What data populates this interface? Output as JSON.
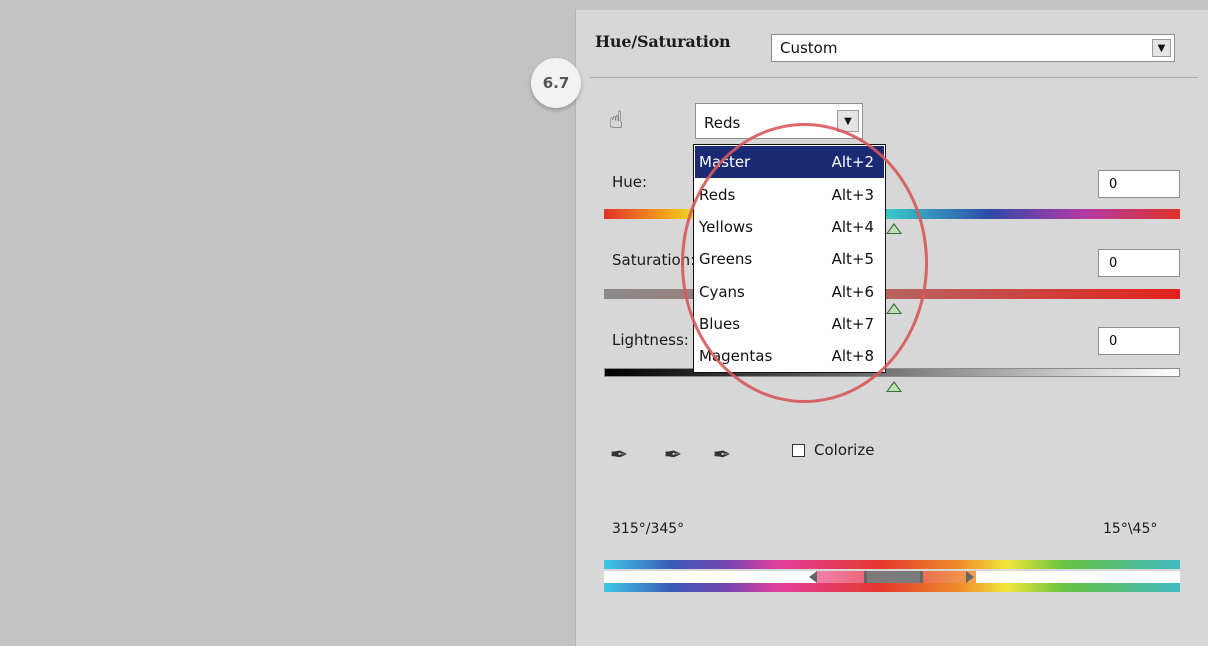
{
  "panel": {
    "title": "Hue/Saturation",
    "preset_value": "Custom",
    "step_badge": "6.7",
    "channel_value": "Reds"
  },
  "menu": {
    "items": [
      {
        "label": "Master",
        "shortcut": "Alt+2",
        "selected": true
      },
      {
        "label": "Reds",
        "shortcut": "Alt+3",
        "selected": false
      },
      {
        "label": "Yellows",
        "shortcut": "Alt+4",
        "selected": false
      },
      {
        "label": "Greens",
        "shortcut": "Alt+5",
        "selected": false
      },
      {
        "label": "Cyans",
        "shortcut": "Alt+6",
        "selected": false
      },
      {
        "label": "Blues",
        "shortcut": "Alt+7",
        "selected": false
      },
      {
        "label": "Magentas",
        "shortcut": "Alt+8",
        "selected": false
      }
    ]
  },
  "sliders": {
    "hue": {
      "label": "Hue:",
      "value": "0"
    },
    "saturation": {
      "label": "Saturation:",
      "value": "0"
    },
    "lightness": {
      "label": "Lightness:",
      "value": "0"
    }
  },
  "colorize": {
    "label": "Colorize",
    "checked": false
  },
  "range": {
    "left": "315°/345°",
    "right": "15°\\45°"
  },
  "icons": {
    "hand": "targeted-adjustment-hand-icon",
    "eyedropper": "eyedropper-icon",
    "eyedropper_add": "eyedropper-add-icon",
    "eyedropper_subtract": "eyedropper-subtract-icon",
    "dropdown": "chevron-down-icon"
  },
  "colors": {
    "menu_selected_bg": "#1b2a74",
    "highlight_circle": "#d7585a"
  }
}
